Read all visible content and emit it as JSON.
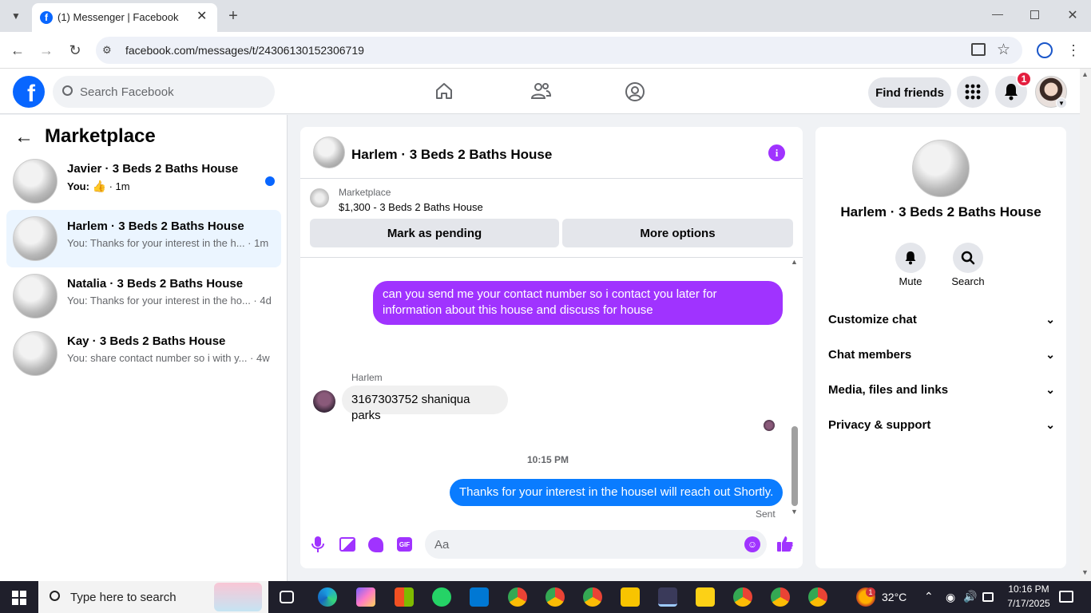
{
  "browser": {
    "tab_title": "(1) Messenger | Facebook",
    "url": "facebook.com/messages/t/24306130152306719"
  },
  "fb": {
    "search_placeholder": "Search Facebook",
    "find_friends": "Find friends",
    "notification_count": "1"
  },
  "left": {
    "heading": "Marketplace",
    "conversations": [
      {
        "title": "Javier · 3 Beds 2 Baths House",
        "prefix": "You:",
        "snippet": " · 1m",
        "unread": true
      },
      {
        "title": "Harlem · 3 Beds 2 Baths House",
        "snippet": "You: Thanks for your interest in the h... · 1m",
        "selected": true
      },
      {
        "title": "Natalia · 3 Beds 2 Baths House",
        "snippet": "You: Thanks for your interest in the ho... · 4d"
      },
      {
        "title": "Kay · 3 Beds 2 Baths House",
        "snippet": "You: share contact number so i with y... · 4w"
      }
    ]
  },
  "chat": {
    "title": "Harlem · 3 Beds 2 Baths House",
    "listing_source": "Marketplace",
    "listing_title": "$1,300 - 3 Beds 2 Baths House",
    "mark_pending": "Mark as pending",
    "more_options": "More options",
    "messages": [
      {
        "from": "me",
        "text": "can you send me your contact number so i contact you later for information about this house and discuss for house"
      },
      {
        "from": "them",
        "sender": "Harlem",
        "text": "3167303752 shaniqua parks"
      },
      {
        "from": "me",
        "text": "Thanks for your interest in the houseI will reach out Shortly."
      }
    ],
    "timestamp": "10:15 PM",
    "sent_label": "Sent",
    "composer_placeholder": "Aa",
    "gif_label": "GIF"
  },
  "info": {
    "title": "Harlem · 3 Beds 2 Baths House",
    "mute": "Mute",
    "search": "Search",
    "sections": [
      "Customize chat",
      "Chat members",
      "Media, files and links",
      "Privacy & support"
    ]
  },
  "taskbar": {
    "search_placeholder": "Type here to search",
    "weather": "32°C",
    "weather_badge": "1",
    "time": "10:16 PM",
    "date": "7/17/2025"
  },
  "colors": {
    "fb_blue": "#0866ff",
    "messenger_purple": "#a033ff",
    "blue_bubble": "#0a7cff",
    "selected_row": "#ebf5ff"
  }
}
